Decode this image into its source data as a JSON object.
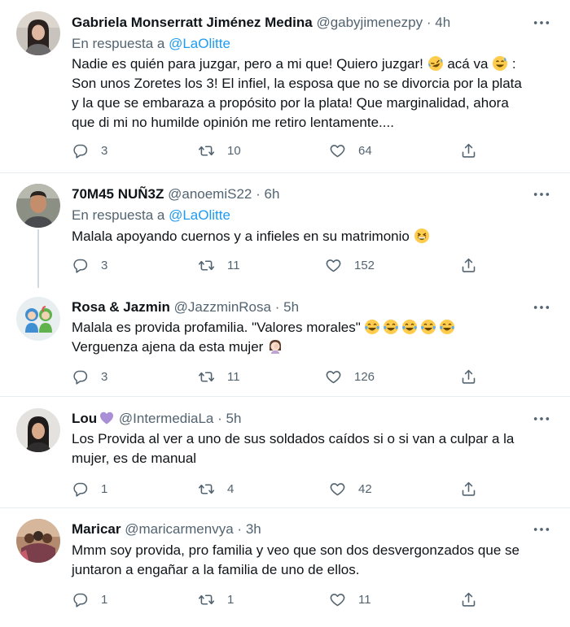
{
  "tweets": [
    {
      "name": "Gabriela Monserratt Jiménez Medina",
      "handle": "@gabyjimenezpy",
      "dot": "·",
      "time": "4h",
      "reply_prefix": "En respuesta a ",
      "reply_mention": "@LaOlitte",
      "text_1": "Nadie es quién para juzgar, pero a mi que! Quiero juzgar! ",
      "text_2": " acá va ",
      "text_3": " :",
      "text_4": "Son unos Zoretes los 3! El infiel, la esposa que no se divorcia por la plata",
      "text_5": "y la que se embaraza a propósito por la plata! Que marginalidad, ahora",
      "text_6": "que di mi no humilde opinión me retiro lentamente....",
      "replies": "3",
      "retweets": "10",
      "likes": "64",
      "emoji": [
        "rolling-on-floor-laughing-emoji",
        "grinning-sweat-emoji"
      ]
    },
    {
      "name": "70M45 NUÑ3Z",
      "handle": "@anoemiS22",
      "dot": "·",
      "time": "6h",
      "reply_prefix": "En respuesta a ",
      "reply_mention": "@LaOlitte",
      "text_1": "Malala apoyando cuernos y a infieles en su matrimonio ",
      "replies": "3",
      "retweets": "11",
      "likes": "152",
      "emoji": [
        "grinning-squinting-emoji"
      ]
    },
    {
      "name": "Rosa & Jazmin",
      "handle": "@JazzminRosa",
      "dot": "·",
      "time": "5h",
      "text_1": "Malala es provida profamilia. \"Valores morales\" ",
      "text_2": "Verguenza ajena da esta mujer ",
      "replies": "3",
      "retweets": "11",
      "likes": "126",
      "emoji": [
        "tears-of-joy-emoji",
        "woman-facepalming-emoji"
      ]
    },
    {
      "name": "Lou",
      "handle": "@IntermediaLa",
      "dot": "·",
      "time": "5h",
      "text_1": "Los Provida al ver a uno de sus soldados caídos si o si van a culpar a la",
      "text_2": "mujer, es de manual",
      "replies": "1",
      "retweets": "4",
      "likes": "42",
      "emoji": [
        "purple-heart-emoji"
      ]
    },
    {
      "name": "Maricar",
      "handle": "@maricarmenvya",
      "dot": "·",
      "time": "3h",
      "text_1": "Mmm soy provida, pro familia y veo que son dos desvergonzados que se",
      "text_2": "juntaron a engañar a la familia de uno de ellos.",
      "replies": "1",
      "retweets": "1",
      "likes": "11"
    }
  ],
  "colors": {
    "text": "#0f1419",
    "secondary": "#536471",
    "link": "#1d9bf0",
    "divider": "#e6ecf0",
    "thread_line": "#cfd9de"
  },
  "icons": [
    "reply-icon",
    "retweet-icon",
    "like-icon",
    "share-icon",
    "more-icon"
  ]
}
